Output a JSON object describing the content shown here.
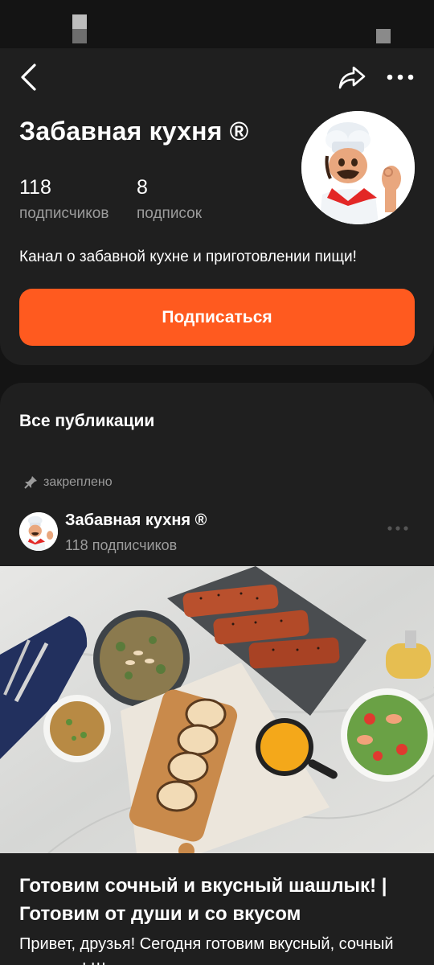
{
  "channel": {
    "title": "Забавная кухня ®",
    "subscribers_count": "118",
    "subscribers_label": "подписчиков",
    "subscriptions_count": "8",
    "subscriptions_label": "подписок",
    "description": "Канал о забавной кухне и приготовлении пищи!",
    "subscribe_label": "Подписаться"
  },
  "toolbar": {
    "back_icon": "chevron-left-icon",
    "share_icon": "share-arrow-icon",
    "more_icon": "more-horizontal-icon"
  },
  "feed": {
    "section_title": "Все публикации",
    "pinned_label": "закреплено",
    "post": {
      "author": "Забавная кухня ®",
      "author_subscribers": "118 подписчиков",
      "title": "Готовим сочный и вкусный шашлык! | Готовим от души и со вкусом",
      "text": "Привет, друзья! Сегодня готовим вкусный, сочный шашлык! Шашлык из свинины на мангале..."
    }
  },
  "colors": {
    "background": "#141414",
    "card": "#1f1f1f",
    "accent": "#ff5a1f",
    "muted_text": "#9b9b9b"
  }
}
